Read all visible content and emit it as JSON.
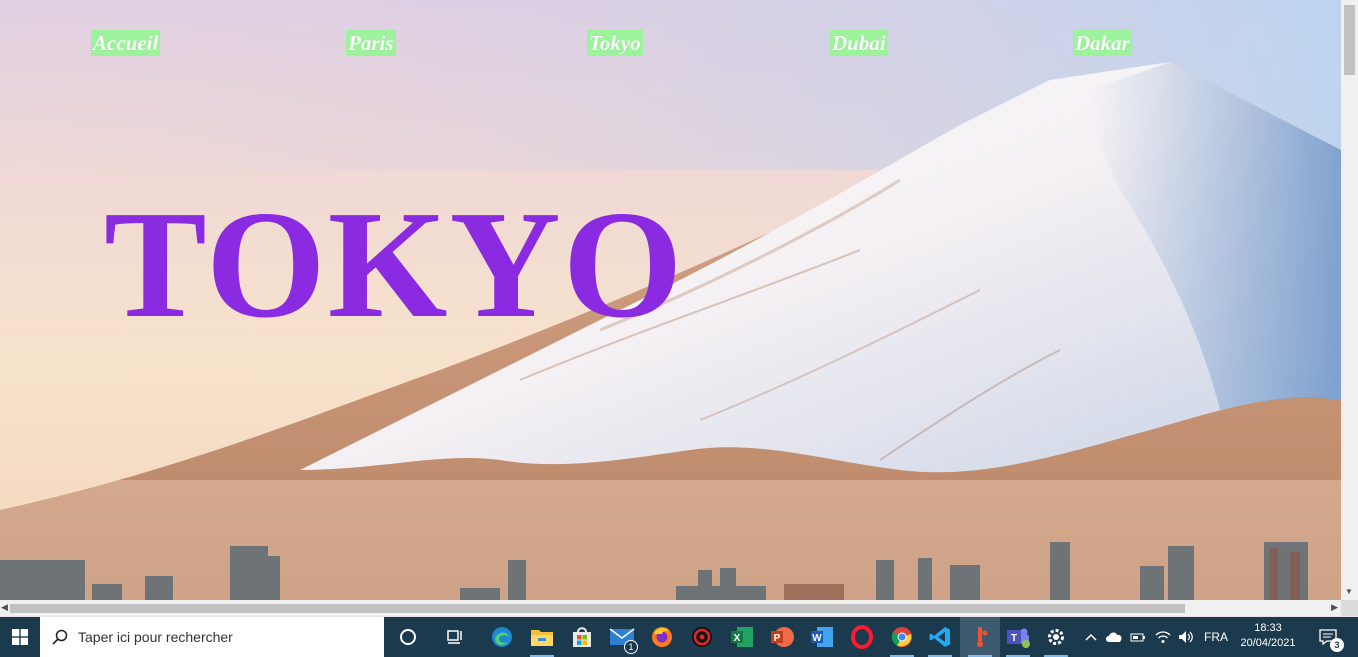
{
  "page": {
    "hero_title": "TOKYO",
    "nav": [
      {
        "label": "Accueil"
      },
      {
        "label": "Paris"
      },
      {
        "label": "Tokyo"
      },
      {
        "label": "Dubai"
      },
      {
        "label": "Dakar"
      }
    ],
    "colors": {
      "title": "#8a2be2",
      "nav_highlight": "#9cf39b",
      "nav_text": "#ffffff"
    }
  },
  "taskbar": {
    "search_placeholder": "Taper ici pour rechercher",
    "apps": [
      {
        "name": "task-view-icon"
      },
      {
        "name": "widgets-icon"
      },
      {
        "name": "edge-icon"
      },
      {
        "name": "file-explorer-icon"
      },
      {
        "name": "store-icon"
      },
      {
        "name": "mail-icon",
        "badge": "1"
      },
      {
        "name": "firefox-icon"
      },
      {
        "name": "antivirus-icon"
      },
      {
        "name": "excel-icon"
      },
      {
        "name": "powerpoint-icon"
      },
      {
        "name": "word-icon"
      },
      {
        "name": "opera-icon"
      },
      {
        "name": "chrome-icon"
      },
      {
        "name": "vscode-icon"
      },
      {
        "name": "git-app-icon"
      },
      {
        "name": "teams-icon"
      },
      {
        "name": "settings-icon"
      }
    ],
    "tray": {
      "language": "FRA",
      "time": "18:33",
      "date": "20/04/2021",
      "notifications": "3"
    }
  }
}
